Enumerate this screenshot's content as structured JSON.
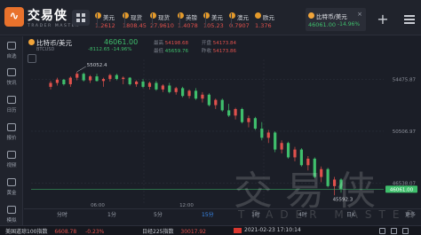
{
  "app": {
    "logo_glyph": "∿",
    "brand": "交易侠",
    "brand_sub": "TRADER MASTER"
  },
  "tickers": [
    {
      "name": "美元",
      "price": "1.2612",
      "dir": "down"
    },
    {
      "name": "现货",
      "price": "1808.45",
      "dir": "down"
    },
    {
      "name": "现货",
      "price": "27.9610",
      "dir": "down"
    },
    {
      "name": "英镑",
      "price": "1.4078",
      "dir": "down"
    },
    {
      "name": "美元",
      "price": "105.23",
      "dir": "down"
    },
    {
      "name": "澳元",
      "price": "0.7907",
      "dir": "down"
    },
    {
      "name": "欧元",
      "price": "1.376",
      "dir": "down"
    }
  ],
  "active_tab": {
    "name": "比特币/美元",
    "price": "46061.00",
    "change_pct": "-14.96%",
    "close_glyph": "×"
  },
  "add_glyph": "+",
  "sidebar": [
    {
      "label": "自选"
    },
    {
      "label": "快讯"
    },
    {
      "label": "日历"
    },
    {
      "label": "报价"
    },
    {
      "label": "视频"
    },
    {
      "label": "黄金"
    },
    {
      "label": "模拟"
    }
  ],
  "instrument": {
    "name": "比特币/美元",
    "symbol": "BTCUSD",
    "price": "46061.00",
    "change": "-8112.65",
    "change_pct": "-14.96%",
    "high_label": "最高",
    "high": "54198.68",
    "open_label": "开盘",
    "open": "54173.84",
    "low_label": "最低",
    "low": "45659.76",
    "prev_label": "昨收",
    "prev": "54173.86"
  },
  "chart_data": {
    "type": "candlestick",
    "y_ticks": [
      "54475.87",
      "50506.97",
      "46538.07"
    ],
    "x_ticks": [
      "06:00",
      "12:00"
    ],
    "annotations": {
      "max": "55052.4",
      "min": "45592.3"
    },
    "last_price_label": "46061.00",
    "ylim": [
      45000,
      56000
    ],
    "candles": [
      [
        53900,
        54350,
        53700,
        54200
      ],
      [
        54200,
        54600,
        54000,
        54450
      ],
      [
        54450,
        54500,
        54000,
        54100
      ],
      [
        54100,
        54700,
        53900,
        54600
      ],
      [
        54600,
        55052,
        54400,
        54900
      ],
      [
        54900,
        55000,
        54300,
        54400
      ],
      [
        54400,
        54800,
        54200,
        54700
      ],
      [
        54700,
        54900,
        54300,
        54350
      ],
      [
        54350,
        54600,
        53900,
        54500
      ],
      [
        54500,
        54900,
        54300,
        54800
      ],
      [
        54800,
        54900,
        54400,
        54500
      ],
      [
        54500,
        54700,
        54100,
        54600
      ],
      [
        54600,
        54650,
        54000,
        54100
      ],
      [
        54100,
        54400,
        53900,
        54300
      ],
      [
        54300,
        54500,
        53800,
        53900
      ],
      [
        53900,
        54300,
        53700,
        54200
      ],
      [
        54200,
        54350,
        53600,
        53700
      ],
      [
        53700,
        54100,
        53500,
        54000
      ],
      [
        54000,
        54200,
        53400,
        53500
      ],
      [
        53500,
        53900,
        53300,
        53800
      ],
      [
        53800,
        53900,
        53100,
        53200
      ],
      [
        53200,
        53700,
        53000,
        53600
      ],
      [
        53600,
        53800,
        52900,
        53000
      ],
      [
        53000,
        53500,
        52700,
        53300
      ],
      [
        53300,
        53400,
        52400,
        52500
      ],
      [
        52500,
        53000,
        52200,
        52900
      ],
      [
        52900,
        53000,
        52000,
        52100
      ],
      [
        52100,
        52600,
        51600,
        51700
      ],
      [
        51700,
        52300,
        51400,
        52200
      ],
      [
        52200,
        52300,
        51100,
        51200
      ],
      [
        51200,
        51700,
        50800,
        51500
      ],
      [
        51500,
        51600,
        50600,
        50700
      ],
      [
        50700,
        51200,
        49800,
        50000
      ],
      [
        50000,
        50600,
        49600,
        50400
      ],
      [
        50400,
        50500,
        48900,
        49100
      ],
      [
        49100,
        49800,
        48800,
        49600
      ],
      [
        49600,
        49700,
        48400,
        48500
      ],
      [
        48500,
        49300,
        48200,
        49100
      ],
      [
        49100,
        49200,
        47800,
        47900
      ],
      [
        47900,
        48600,
        47500,
        48400
      ],
      [
        48400,
        48500,
        46900,
        47000
      ],
      [
        47000,
        47800,
        46600,
        47600
      ],
      [
        47600,
        47700,
        46200,
        46300
      ],
      [
        46300,
        47000,
        45592,
        46800
      ],
      [
        46800,
        46900,
        45800,
        46061
      ]
    ]
  },
  "watermark": {
    "cn": "交易侠",
    "en": "TRADER MASTER"
  },
  "periods": [
    {
      "label": "分时",
      "active": false
    },
    {
      "label": "1分",
      "active": false
    },
    {
      "label": "5分",
      "active": false
    },
    {
      "label": "15分",
      "active": true
    },
    {
      "label": "1时",
      "active": false
    },
    {
      "label": "4时",
      "active": false
    },
    {
      "label": "日K",
      "active": false
    }
  ],
  "period_more": "更多",
  "bottom": {
    "items": [
      {
        "name": "美国道琼100指数",
        "value": "6608.78",
        "change": "-0.23%",
        "dir": "down"
      },
      {
        "name": "日经225指数",
        "value": "30017.92",
        "change": "",
        "dir": "down"
      }
    ],
    "clock": "2021-02-23 17:10:14"
  },
  "colors": {
    "up": "#3fbf6c",
    "down": "#e0514c",
    "accent": "#3a8bf0",
    "brand": "#e9722c"
  }
}
